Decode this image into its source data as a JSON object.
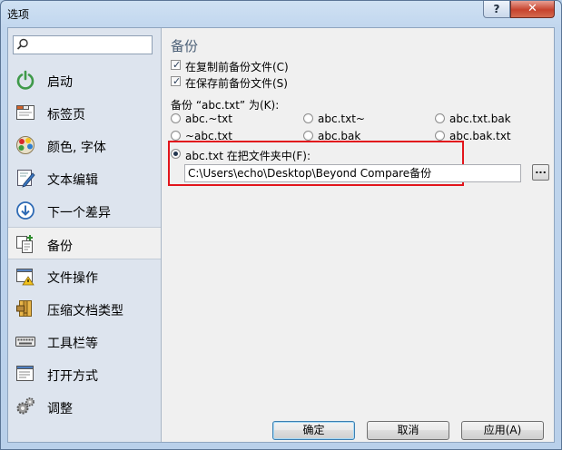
{
  "window": {
    "title": "选项",
    "help_label": "?",
    "close_label": "✕"
  },
  "search": {
    "placeholder": ""
  },
  "sidebar": {
    "items": [
      {
        "label": "启动",
        "icon": "power-icon"
      },
      {
        "label": "标签页",
        "icon": "tabs-icon"
      },
      {
        "label": "颜色, 字体",
        "icon": "palette-icon"
      },
      {
        "label": "文本编辑",
        "icon": "text-edit-icon"
      },
      {
        "label": "下一个差异",
        "icon": "next-difference-icon"
      },
      {
        "label": "备份",
        "icon": "backup-icon",
        "selected": true
      },
      {
        "label": "文件操作",
        "icon": "file-operations-icon"
      },
      {
        "label": "压缩文档类型",
        "icon": "archive-icon"
      },
      {
        "label": "工具栏等",
        "icon": "keyboard-icon"
      },
      {
        "label": "打开方式",
        "icon": "open-with-icon"
      },
      {
        "label": "调整",
        "icon": "gears-icon"
      }
    ]
  },
  "content": {
    "section_title": "备份",
    "checkbox_before_copy": {
      "label": "在复制前备份文件(C)",
      "checked": true
    },
    "checkbox_before_save": {
      "label": "在保存前备份文件(S)",
      "checked": true
    },
    "backup_as_label": "备份 “abc.txt” 为(K):",
    "options": [
      {
        "label": "abc.~txt",
        "selected": false
      },
      {
        "label": "abc.txt~",
        "selected": false
      },
      {
        "label": "abc.txt.bak",
        "selected": false
      },
      {
        "label": "~abc.txt",
        "selected": false
      },
      {
        "label": "abc.bak",
        "selected": false
      },
      {
        "label": "abc.bak.txt",
        "selected": false
      },
      {
        "label": "abc.txt 在把文件夹中(F):",
        "selected": true
      }
    ],
    "folder_path": "C:\\Users\\echo\\Desktop\\Beyond Compare备份",
    "browse_label": "..."
  },
  "buttons": {
    "ok": "确定",
    "cancel": "取消",
    "apply": "应用(A)"
  },
  "colors": {
    "highlight_border": "#e2151c",
    "section_title": "#4c6077",
    "sidebar_bg": "#dde4ee"
  }
}
